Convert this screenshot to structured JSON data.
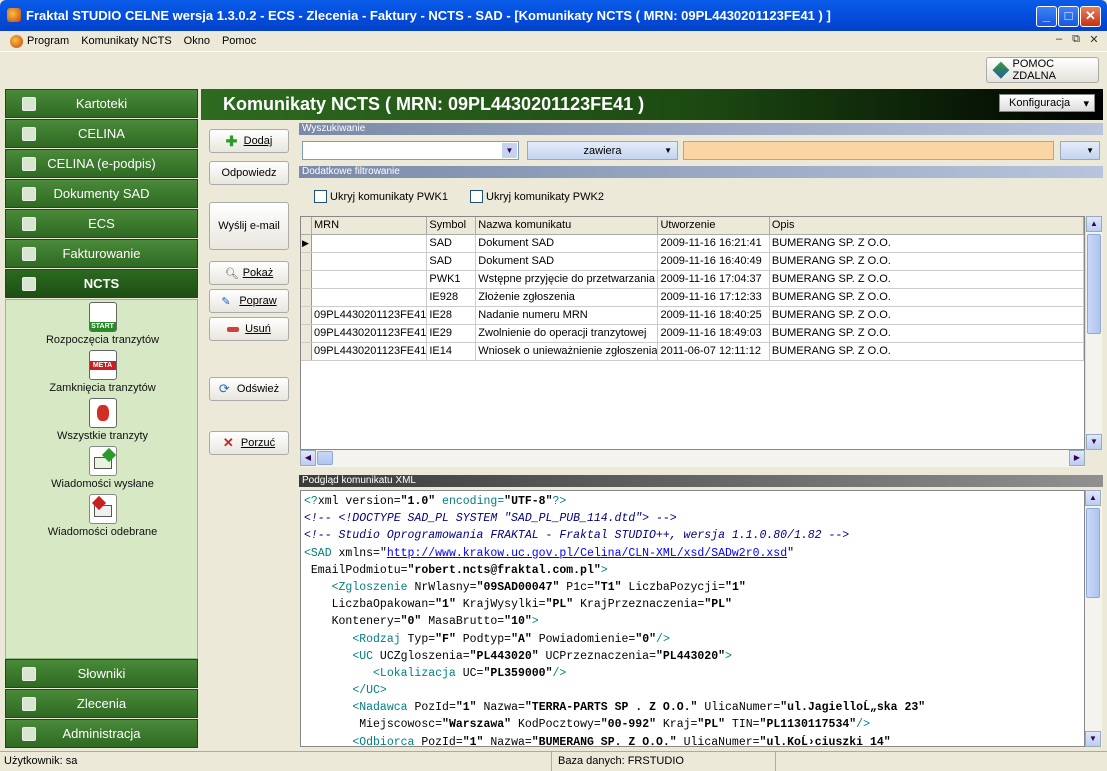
{
  "window": {
    "title": "Fraktal STUDIO CELNE  wersja 1.3.0.2 - ECS - Zlecenia - Faktury - NCTS - SAD - [Komunikaty NCTS ( MRN: 09PL4430201123FE41 ) ]"
  },
  "menu": [
    "Program",
    "Komunikaty NCTS",
    "Okno",
    "Pomoc"
  ],
  "toolbar": {
    "remote_help": "POMOC ZDALNA"
  },
  "sidebar": {
    "top": [
      {
        "label": "Kartoteki"
      },
      {
        "label": "CELINA"
      },
      {
        "label": "CELINA (e-podpis)"
      },
      {
        "label": "Dokumenty SAD"
      },
      {
        "label": "ECS"
      },
      {
        "label": "Fakturowanie"
      },
      {
        "label": "NCTS"
      }
    ],
    "nav": [
      {
        "label": "Rozpoczęcia tranzytów",
        "badge": "START"
      },
      {
        "label": "Zamknięcia tranzytów",
        "badge": "META"
      },
      {
        "label": "Wszystkie tranzyty"
      },
      {
        "label": "Wiadomości wysłane"
      },
      {
        "label": "Wiadomości odebrane"
      }
    ],
    "bottom": [
      {
        "label": "Słowniki"
      },
      {
        "label": "Zlecenia"
      },
      {
        "label": "Administracja"
      }
    ]
  },
  "header": {
    "title": "Komunikaty NCTS ( MRN: 09PL4430201123FE41 )",
    "config": "Konfiguracja"
  },
  "actions": {
    "add": "Dodaj",
    "reply": "Odpowiedz",
    "send_email": "Wyślij e-mail",
    "show": "Pokaż",
    "edit": "Popraw",
    "delete": "Usuń",
    "refresh": "Odśwież",
    "abandon": "Porzuć"
  },
  "search": {
    "section": "Wyszukiwanie",
    "operator": "zawiera"
  },
  "filter": {
    "section": "Dodatkowe filtrowanie",
    "hide_pwk1": "Ukryj komunikaty PWK1",
    "hide_pwk2": "Ukryj komunikaty PWK2"
  },
  "grid": {
    "columns": [
      "MRN",
      "Symbol",
      "Nazwa komunikatu",
      "Utworzenie",
      "Opis"
    ],
    "rows": [
      [
        "",
        "SAD",
        "Dokument SAD",
        "2009-11-16 16:21:41",
        "BUMERANG SP. Z O.O."
      ],
      [
        "",
        "SAD",
        "Dokument SAD",
        "2009-11-16 16:40:49",
        "BUMERANG SP. Z O.O."
      ],
      [
        "",
        "PWK1",
        "Wstępne przyjęcie do przetwarzania",
        "2009-11-16 17:04:37",
        "BUMERANG SP. Z O.O."
      ],
      [
        "",
        "IE928",
        "Złożenie zgłoszenia",
        "2009-11-16 17:12:33",
        "BUMERANG SP. Z O.O."
      ],
      [
        "09PL4430201123FE41",
        "IE28",
        "Nadanie numeru MRN",
        "2009-11-16 18:40:25",
        "BUMERANG SP. Z O.O."
      ],
      [
        "09PL4430201123FE41",
        "IE29",
        "Zwolnienie do operacji tranzytowej",
        "2009-11-16 18:49:03",
        "BUMERANG SP. Z O.O."
      ],
      [
        "09PL4430201123FE41",
        "IE14",
        "Wniosek o unieważnienie zgłoszenia",
        "2011-06-07 12:11:12",
        "BUMERANG SP. Z O.O."
      ]
    ]
  },
  "xml": {
    "section": "Podgląd komunikatu XML",
    "lines": [
      {
        "indent": 0,
        "parts": [
          [
            "tg",
            "<?"
          ],
          [
            "nm",
            "xml version="
          ],
          [
            "st",
            "\"1.0\""
          ],
          [
            "tg",
            " encoding="
          ],
          [
            "st",
            "\"UTF-8\""
          ],
          [
            "tg",
            "?>"
          ]
        ]
      },
      {
        "indent": 0,
        "parts": [
          [
            "cm",
            "<!-- <!DOCTYPE SAD_PL SYSTEM \"SAD_PL_PUB_114.dtd\"> -->"
          ]
        ]
      },
      {
        "indent": 0,
        "parts": [
          [
            "cm",
            "<!-- Studio Oprogramowania FRAKTAL - Fraktal STUDIO++, wersja 1.1.0.80/1.82 -->"
          ]
        ]
      },
      {
        "indent": 0,
        "parts": [
          [
            "tg",
            "<SAD "
          ],
          [
            "nm",
            "xmlns="
          ],
          [
            "nm",
            "\""
          ],
          [
            "lk",
            "http://www.krakow.uc.gov.pl/Celina/CLN-XML/xsd/SADw2r0.xsd"
          ],
          [
            "nm",
            "\""
          ]
        ]
      },
      {
        "indent": 1,
        "parts": [
          [
            "nm",
            "EmailPodmiotu="
          ],
          [
            "st",
            "\"robert.ncts@fraktal.com.pl\""
          ],
          [
            "tg",
            ">"
          ]
        ]
      },
      {
        "indent": 4,
        "parts": [
          [
            "tg",
            "<Zgloszenie "
          ],
          [
            "nm",
            "NrWlasny="
          ],
          [
            "st",
            "\"09SAD00047\""
          ],
          [
            "nm",
            " P1c="
          ],
          [
            "st",
            "\"T1\""
          ],
          [
            "nm",
            " LiczbaPozycji="
          ],
          [
            "st",
            "\"1\""
          ]
        ]
      },
      {
        "indent": 4,
        "parts": [
          [
            "nm",
            "LiczbaOpakowan="
          ],
          [
            "st",
            "\"1\""
          ],
          [
            "nm",
            " KrajWysylki="
          ],
          [
            "st",
            "\"PL\""
          ],
          [
            "nm",
            " KrajPrzeznaczenia="
          ],
          [
            "st",
            "\"PL\""
          ]
        ]
      },
      {
        "indent": 4,
        "parts": [
          [
            "nm",
            "Kontenery="
          ],
          [
            "st",
            "\"0\""
          ],
          [
            "nm",
            " MasaBrutto="
          ],
          [
            "st",
            "\"10\""
          ],
          [
            "tg",
            ">"
          ]
        ]
      },
      {
        "indent": 7,
        "parts": [
          [
            "tg",
            "<Rodzaj "
          ],
          [
            "nm",
            "Typ="
          ],
          [
            "st",
            "\"F\""
          ],
          [
            "nm",
            " Podtyp="
          ],
          [
            "st",
            "\"A\""
          ],
          [
            "nm",
            " Powiadomienie="
          ],
          [
            "st",
            "\"0\""
          ],
          [
            "tg",
            "/>"
          ]
        ]
      },
      {
        "indent": 7,
        "parts": [
          [
            "tg",
            "<UC "
          ],
          [
            "nm",
            "UCZgloszenia="
          ],
          [
            "st",
            "\"PL443020\""
          ],
          [
            "nm",
            " UCPrzeznaczenia="
          ],
          [
            "st",
            "\"PL443020\""
          ],
          [
            "tg",
            ">"
          ]
        ]
      },
      {
        "indent": 10,
        "parts": [
          [
            "tg",
            "<Lokalizacja "
          ],
          [
            "nm",
            "UC="
          ],
          [
            "st",
            "\"PL359000\""
          ],
          [
            "tg",
            "/>"
          ]
        ]
      },
      {
        "indent": 7,
        "parts": [
          [
            "tg",
            "</UC>"
          ]
        ]
      },
      {
        "indent": 7,
        "parts": [
          [
            "tg",
            "<Nadawca "
          ],
          [
            "nm",
            "PozId="
          ],
          [
            "st",
            "\"1\""
          ],
          [
            "nm",
            " Nazwa="
          ],
          [
            "st",
            "\"TERRA-PARTS SP . Z O.O.\""
          ],
          [
            "nm",
            " UlicaNumer="
          ],
          [
            "st",
            "\"ul.JagielloĹ„ska 23\""
          ]
        ]
      },
      {
        "indent": 8,
        "parts": [
          [
            "nm",
            "Miejscowosc="
          ],
          [
            "st",
            "\"Warszawa\""
          ],
          [
            "nm",
            " KodPocztowy="
          ],
          [
            "st",
            "\"00-992\""
          ],
          [
            "nm",
            " Kraj="
          ],
          [
            "st",
            "\"PL\""
          ],
          [
            "nm",
            " TIN="
          ],
          [
            "st",
            "\"PL1130117534\""
          ],
          [
            "tg",
            "/>"
          ]
        ]
      },
      {
        "indent": 7,
        "parts": [
          [
            "tg",
            "<Odbiorca "
          ],
          [
            "nm",
            "PozId="
          ],
          [
            "st",
            "\"1\""
          ],
          [
            "nm",
            " Nazwa="
          ],
          [
            "st",
            "\"BUMERANG SP. Z O.O.\""
          ],
          [
            "nm",
            " UlicaNumer="
          ],
          [
            "st",
            "\"ul.KoĹ›ciuszki 14\""
          ]
        ]
      }
    ]
  },
  "status": {
    "user": "Użytkownik: sa",
    "db": "Baza danych: FRSTUDIO"
  }
}
